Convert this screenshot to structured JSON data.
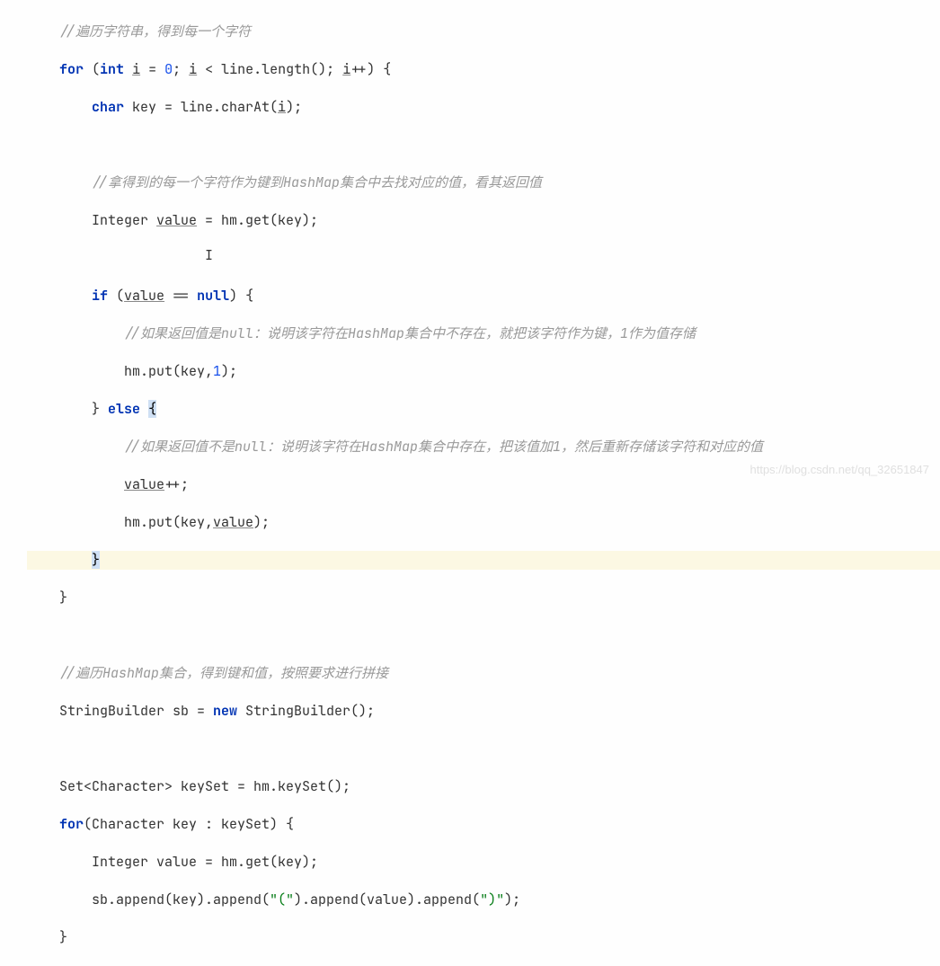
{
  "code": {
    "c1": "//遍历字符串，得到每一个字符",
    "l2": {
      "kw_for": "for",
      "kw_int": "int",
      "var_i": "i",
      "eq": " = ",
      "zero": "0",
      "semi1": "; ",
      "var_i2": "i",
      "lt": " < ",
      "call": "line.length(); ",
      "var_i3": "i",
      "inc": "++) {"
    },
    "l3": {
      "kw_char": "char",
      "rest": " key = line.charAt(",
      "var_i": "i",
      "close": ");"
    },
    "c2": "//拿得到的每一个字符作为键到HashMap集合中去找对应的值，看其返回值",
    "l5": {
      "type": "Integer ",
      "var": "value",
      "rest": " = hm.get(key);"
    },
    "cursor_i": "I",
    "l7": {
      "kw_if": "if",
      "open": " (",
      "var": "value",
      "eq": " == ",
      "null": "null",
      "close": ") {"
    },
    "c3": "//如果返回值是null：说明该字符在HashMap集合中不存在，就把该字符作为键，1作为值存储",
    "l9": {
      "call": "hm.put(key,",
      "num": "1",
      "close": ");"
    },
    "l10": {
      "close": "} ",
      "kw_else": "else",
      "brace": " {"
    },
    "c4": "//如果返回值不是null：说明该字符在HashMap集合中存在，把该值加1，然后重新存储该字符和对应的值",
    "l12": {
      "var": "value",
      "inc": "++;"
    },
    "l13": {
      "call": "hm.put(key,",
      "var": "value",
      "close": ");"
    },
    "l14": "}",
    "l15": "}",
    "c5": "//遍历HashMap集合，得到键和值，按照要求进行拼接",
    "l17": {
      "pre": "StringBuilder sb = ",
      "kw_new": "new",
      "post": " StringBuilder();"
    },
    "l18": "Set<Character> keySet = hm.keySet();",
    "l19": {
      "kw_for": "for",
      "rest": "(Character key : keySet) {"
    },
    "l20": "Integer value = hm.get(key);",
    "l21": {
      "pre": "sb.append(key).append(",
      "s1": "\"(\"",
      "mid1": ").append(value).append(",
      "s2": "\")\"",
      "post": ");"
    },
    "l22": "}"
  },
  "watermark": "https://blog.csdn.net/qq_32651847"
}
